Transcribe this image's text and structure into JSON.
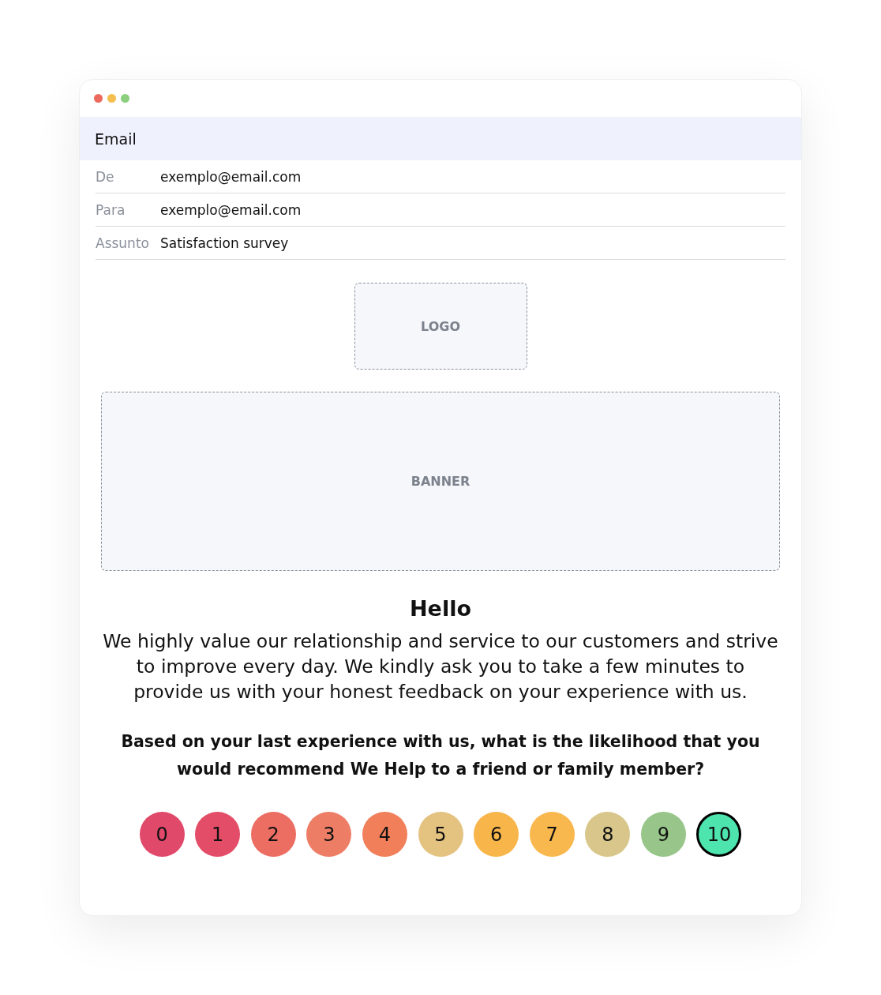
{
  "window": {
    "controls": [
      {
        "color": "#ec6a5e"
      },
      {
        "color": "#f4bf4f"
      },
      {
        "color": "#8ccf7e"
      }
    ]
  },
  "header": {
    "title": "Email"
  },
  "fields": [
    {
      "label": "De",
      "value": "exemplo@email.com"
    },
    {
      "label": "Para",
      "value": "exemplo@email.com"
    },
    {
      "label": "Assunto",
      "value": "Satisfaction survey"
    }
  ],
  "logo": {
    "label": "LOGO"
  },
  "banner": {
    "label": "BANNER"
  },
  "greeting": "Hello",
  "message": "We highly value our relationship and service to our customers and strive to improve every day. We kindly ask you to take a few minutes to provide us with your honest feedback on your experience with us.",
  "question": "Based on your last experience with us, what is the likelihood that you would recommend We Help to a friend or family member?",
  "scores": [
    {
      "label": "0",
      "color": "#e0496a",
      "selected": false
    },
    {
      "label": "1",
      "color": "#e44d68",
      "selected": false
    },
    {
      "label": "2",
      "color": "#ec6d62",
      "selected": false
    },
    {
      "label": "3",
      "color": "#ee7d66",
      "selected": false
    },
    {
      "label": "4",
      "color": "#f07f5a",
      "selected": false
    },
    {
      "label": "5",
      "color": "#e4c280",
      "selected": false
    },
    {
      "label": "6",
      "color": "#f8b54a",
      "selected": false
    },
    {
      "label": "7",
      "color": "#f9b84d",
      "selected": false
    },
    {
      "label": "8",
      "color": "#d9c68b",
      "selected": false
    },
    {
      "label": "9",
      "color": "#98c68a",
      "selected": false
    },
    {
      "label": "10",
      "color": "#4ee4ae",
      "selected": true
    }
  ]
}
